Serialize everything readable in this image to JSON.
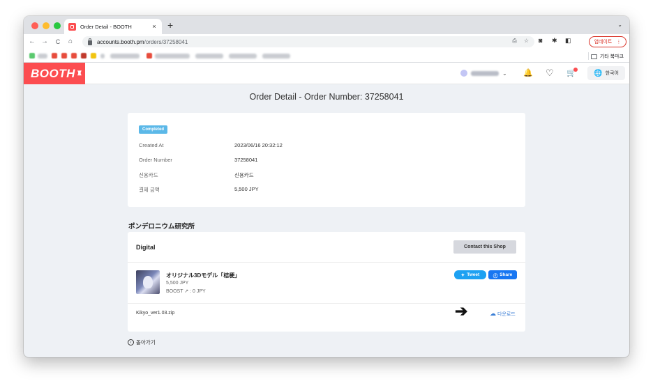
{
  "browser": {
    "tab_title": "Order Detail - BOOTH",
    "tab_close": "×",
    "new_tab": "+",
    "tab_dropdown": "⌄",
    "url_host": "accounts.booth.pm",
    "url_path": "/orders/37258041",
    "update_label": "업데이트",
    "update_menu": "⋮",
    "other_bookmarks": "기타 북마크",
    "nav": {
      "back": "←",
      "forward": "→",
      "reload": "C",
      "home": "⌂"
    },
    "omni_icons": {
      "share": "⎙",
      "star": "☆"
    },
    "toolbar_icons": {
      "camera": "◙",
      "extensions": "✱",
      "sidepanel": "◧"
    }
  },
  "site": {
    "logo": "BOOTH",
    "logo_mark": "♜",
    "lang_label": "한국어",
    "header_icons": {
      "bell": "🔔",
      "heart": "♡",
      "cart": "🛒",
      "globe": "🌐",
      "caret": "⌄"
    }
  },
  "page": {
    "title": "Order Detail - Order Number: 37258041",
    "status_badge": "Completed",
    "info": [
      {
        "label": "Created At",
        "value": "2023/06/16 20:32:12"
      },
      {
        "label": "Order Number",
        "value": "37258041"
      },
      {
        "label": "신용카드",
        "value": "신용카드"
      },
      {
        "label": "결제 금액",
        "value": "5,500 JPY"
      }
    ],
    "shop_name": "ポンデロニウム研究所",
    "section_title": "Digital",
    "contact_button": "Contact this Shop",
    "item": {
      "title": "オリジナル3Dモデル「桔梗」",
      "price": "5,500 JPY",
      "boost": "BOOST ↗ : 0 JPY"
    },
    "tweet_label": "Tweet",
    "share_label": "Share",
    "file_name": "Kikyo_ver1.03.zip",
    "arrow": "➔",
    "download_label": "다운로드",
    "back_label": "돌아가기"
  },
  "colors": {
    "brand": "#fc4d50",
    "badge": "#5bb8e8",
    "twitter": "#1da1f2",
    "facebook": "#1877f2",
    "link": "#3c7fd6"
  }
}
